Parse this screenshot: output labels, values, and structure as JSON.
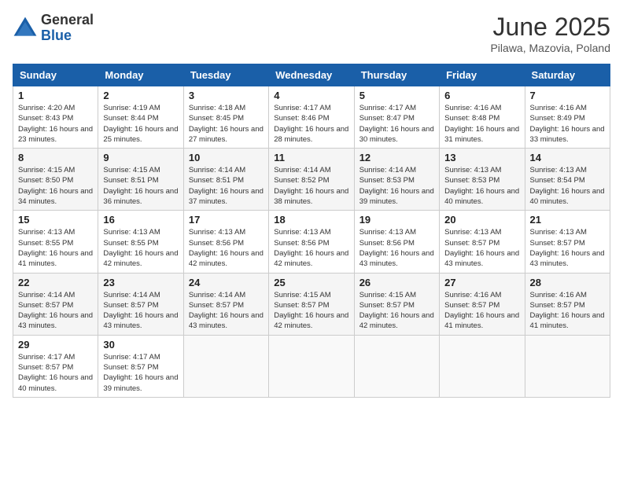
{
  "header": {
    "logo_general": "General",
    "logo_blue": "Blue",
    "month_title": "June 2025",
    "location": "Pilawa, Mazovia, Poland"
  },
  "days_of_week": [
    "Sunday",
    "Monday",
    "Tuesday",
    "Wednesday",
    "Thursday",
    "Friday",
    "Saturday"
  ],
  "weeks": [
    [
      {
        "day": 1,
        "sunrise": "4:20 AM",
        "sunset": "8:43 PM",
        "daylight": "16 hours and 23 minutes."
      },
      {
        "day": 2,
        "sunrise": "4:19 AM",
        "sunset": "8:44 PM",
        "daylight": "16 hours and 25 minutes."
      },
      {
        "day": 3,
        "sunrise": "4:18 AM",
        "sunset": "8:45 PM",
        "daylight": "16 hours and 27 minutes."
      },
      {
        "day": 4,
        "sunrise": "4:17 AM",
        "sunset": "8:46 PM",
        "daylight": "16 hours and 28 minutes."
      },
      {
        "day": 5,
        "sunrise": "4:17 AM",
        "sunset": "8:47 PM",
        "daylight": "16 hours and 30 minutes."
      },
      {
        "day": 6,
        "sunrise": "4:16 AM",
        "sunset": "8:48 PM",
        "daylight": "16 hours and 31 minutes."
      },
      {
        "day": 7,
        "sunrise": "4:16 AM",
        "sunset": "8:49 PM",
        "daylight": "16 hours and 33 minutes."
      }
    ],
    [
      {
        "day": 8,
        "sunrise": "4:15 AM",
        "sunset": "8:50 PM",
        "daylight": "16 hours and 34 minutes."
      },
      {
        "day": 9,
        "sunrise": "4:15 AM",
        "sunset": "8:51 PM",
        "daylight": "16 hours and 36 minutes."
      },
      {
        "day": 10,
        "sunrise": "4:14 AM",
        "sunset": "8:51 PM",
        "daylight": "16 hours and 37 minutes."
      },
      {
        "day": 11,
        "sunrise": "4:14 AM",
        "sunset": "8:52 PM",
        "daylight": "16 hours and 38 minutes."
      },
      {
        "day": 12,
        "sunrise": "4:14 AM",
        "sunset": "8:53 PM",
        "daylight": "16 hours and 39 minutes."
      },
      {
        "day": 13,
        "sunrise": "4:13 AM",
        "sunset": "8:53 PM",
        "daylight": "16 hours and 40 minutes."
      },
      {
        "day": 14,
        "sunrise": "4:13 AM",
        "sunset": "8:54 PM",
        "daylight": "16 hours and 40 minutes."
      }
    ],
    [
      {
        "day": 15,
        "sunrise": "4:13 AM",
        "sunset": "8:55 PM",
        "daylight": "16 hours and 41 minutes."
      },
      {
        "day": 16,
        "sunrise": "4:13 AM",
        "sunset": "8:55 PM",
        "daylight": "16 hours and 42 minutes."
      },
      {
        "day": 17,
        "sunrise": "4:13 AM",
        "sunset": "8:56 PM",
        "daylight": "16 hours and 42 minutes."
      },
      {
        "day": 18,
        "sunrise": "4:13 AM",
        "sunset": "8:56 PM",
        "daylight": "16 hours and 42 minutes."
      },
      {
        "day": 19,
        "sunrise": "4:13 AM",
        "sunset": "8:56 PM",
        "daylight": "16 hours and 43 minutes."
      },
      {
        "day": 20,
        "sunrise": "4:13 AM",
        "sunset": "8:57 PM",
        "daylight": "16 hours and 43 minutes."
      },
      {
        "day": 21,
        "sunrise": "4:13 AM",
        "sunset": "8:57 PM",
        "daylight": "16 hours and 43 minutes."
      }
    ],
    [
      {
        "day": 22,
        "sunrise": "4:14 AM",
        "sunset": "8:57 PM",
        "daylight": "16 hours and 43 minutes."
      },
      {
        "day": 23,
        "sunrise": "4:14 AM",
        "sunset": "8:57 PM",
        "daylight": "16 hours and 43 minutes."
      },
      {
        "day": 24,
        "sunrise": "4:14 AM",
        "sunset": "8:57 PM",
        "daylight": "16 hours and 43 minutes."
      },
      {
        "day": 25,
        "sunrise": "4:15 AM",
        "sunset": "8:57 PM",
        "daylight": "16 hours and 42 minutes."
      },
      {
        "day": 26,
        "sunrise": "4:15 AM",
        "sunset": "8:57 PM",
        "daylight": "16 hours and 42 minutes."
      },
      {
        "day": 27,
        "sunrise": "4:16 AM",
        "sunset": "8:57 PM",
        "daylight": "16 hours and 41 minutes."
      },
      {
        "day": 28,
        "sunrise": "4:16 AM",
        "sunset": "8:57 PM",
        "daylight": "16 hours and 41 minutes."
      }
    ],
    [
      {
        "day": 29,
        "sunrise": "4:17 AM",
        "sunset": "8:57 PM",
        "daylight": "16 hours and 40 minutes."
      },
      {
        "day": 30,
        "sunrise": "4:17 AM",
        "sunset": "8:57 PM",
        "daylight": "16 hours and 39 minutes."
      },
      null,
      null,
      null,
      null,
      null
    ]
  ],
  "labels": {
    "sunrise": "Sunrise:",
    "sunset": "Sunset:",
    "daylight": "Daylight:"
  }
}
